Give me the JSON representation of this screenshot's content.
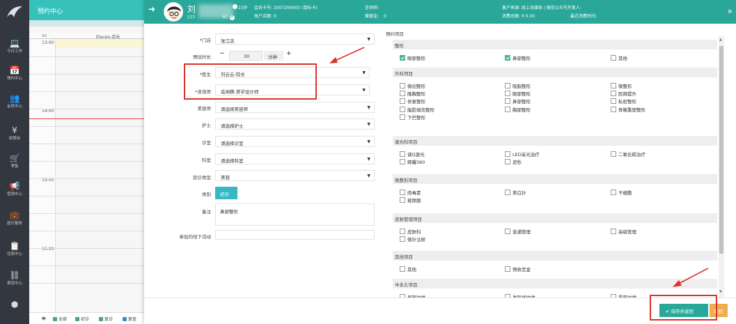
{
  "colors": {
    "teal": "#29a89a",
    "header": "#36c2bb",
    "nav": "#33373f",
    "red": "#d8322b",
    "orange": "#f0ad4e",
    "green": "#4cb58a"
  },
  "app": {
    "title": "预约中心"
  },
  "nav": [
    {
      "icon": "laptop-icon",
      "glyph": "💻",
      "label": "今日工作"
    },
    {
      "icon": "calendar-icon",
      "glyph": "📅",
      "label": "预约中心"
    },
    {
      "icon": "users-icon",
      "glyph": "👥",
      "label": "会员中心"
    },
    {
      "icon": "yen-icon",
      "glyph": "¥",
      "label": "收银台"
    },
    {
      "icon": "cart-icon",
      "glyph": "🛒",
      "label": "零售"
    },
    {
      "icon": "megaphone-icon",
      "glyph": "📢",
      "label": "营销中心"
    },
    {
      "icon": "medical-kit-icon",
      "glyph": "💼",
      "label": "医疗服务"
    },
    {
      "icon": "clipboard-icon",
      "glyph": "📋",
      "label": "住院中心"
    },
    {
      "icon": "org-chart-icon",
      "glyph": "⛓",
      "label": "渠道中心"
    },
    {
      "icon": "cubes-icon",
      "glyph": "⬢",
      "label": ""
    }
  ],
  "calendar": {
    "col_head": "Eleven-店长",
    "times": [
      "13:00",
      "14:00",
      "15:00",
      "16:00"
    ],
    "legend": [
      "全部",
      "初诊",
      "复诊",
      "复查"
    ]
  },
  "customer": {
    "name": "刘",
    "phone_prefix": "13",
    "phone_suffix": "67",
    "age": "23岁",
    "card_label": "会员卡号:",
    "card_no": "2007290005 (鼠标卡)",
    "balance_label": "账户余额:",
    "balance": "0",
    "consultant_label": "咨询师:",
    "consultant": "",
    "deposit_label": "赠留金:",
    "deposit": "0",
    "source_label": "客户来源:",
    "source": "线上自媒体 / 微信公众号开发人:",
    "spent_label": "消费总额:",
    "spent": "¥ 0.00",
    "last_label": "最近消费时间:",
    "last": ""
  },
  "form": {
    "store_label": "*门店",
    "store": "张江店",
    "duration_label": "预估时长",
    "duration": "30",
    "duration_unit": "分钟",
    "minus": "−",
    "plus": "+",
    "doctor_label": "*医生",
    "doctor": "刘云云-院长",
    "consultant_label": "*咨询师",
    "consultant": "岳帅腾-美学设计师",
    "beautician_label": "美容师",
    "beautician": "请选择美容师",
    "nurse_label": "护士",
    "nurse": "请选择护士",
    "room_label": "诊室",
    "room": "请选择诊室",
    "dept_label": "科室",
    "dept": "请选择科室",
    "visit_type_label": "就诊类型",
    "visit_type": "美容",
    "category_label": "类别",
    "category": "初诊",
    "remark_label": "备注",
    "remark": "鼻部整形",
    "activity_label": "参加的线下活动",
    "activity": ""
  },
  "projects": {
    "title": "预约项目",
    "sections": [
      {
        "title": "整形",
        "items": [
          {
            "label": "眼部整形",
            "on": true
          },
          {
            "label": "鼻部整形",
            "on": true
          },
          {
            "label": "其他",
            "on": false
          }
        ]
      },
      {
        "title": "外科项目",
        "items": [
          {
            "label": "微创整形"
          },
          {
            "label": "吸脂整形"
          },
          {
            "label": "微整形"
          },
          {
            "label": "隆胸整形"
          },
          {
            "label": "眼部整形"
          },
          {
            "label": "脸颊提升"
          },
          {
            "label": "修复整形"
          },
          {
            "label": "鼻部整形"
          },
          {
            "label": "私密整形"
          },
          {
            "label": "脂肪填充整形"
          },
          {
            "label": "胸部整形"
          },
          {
            "label": "骨骼重塑整形"
          },
          {
            "label": "下巴整形"
          }
        ]
      },
      {
        "title": "激光科项目",
        "items": [
          {
            "label": "调Q激光"
          },
          {
            "label": "LED采光治疗"
          },
          {
            "label": "二氧化碳治疗"
          },
          {
            "label": "辉耀360"
          },
          {
            "label": "皮秒"
          }
        ]
      },
      {
        "title": "微整形项目",
        "items": [
          {
            "label": "肉毒素"
          },
          {
            "label": "美白针"
          },
          {
            "label": "干细胞"
          },
          {
            "label": "玻尿酸"
          }
        ]
      },
      {
        "title": "皮肤管理项目",
        "items": [
          {
            "label": "皮肤科"
          },
          {
            "label": "普通管理"
          },
          {
            "label": "高级管理"
          },
          {
            "label": "微针注射"
          }
        ]
      },
      {
        "title": "其他项目",
        "items": [
          {
            "label": "其他"
          },
          {
            "label": "预收定金"
          }
        ]
      },
      {
        "title": "半永久项目",
        "items": [
          {
            "label": "眉部纹绣"
          },
          {
            "label": "发际线纹绣"
          },
          {
            "label": "唇部纹绣"
          }
        ]
      }
    ]
  },
  "footer": {
    "save": "保存并返回",
    "cancel": "返回"
  }
}
